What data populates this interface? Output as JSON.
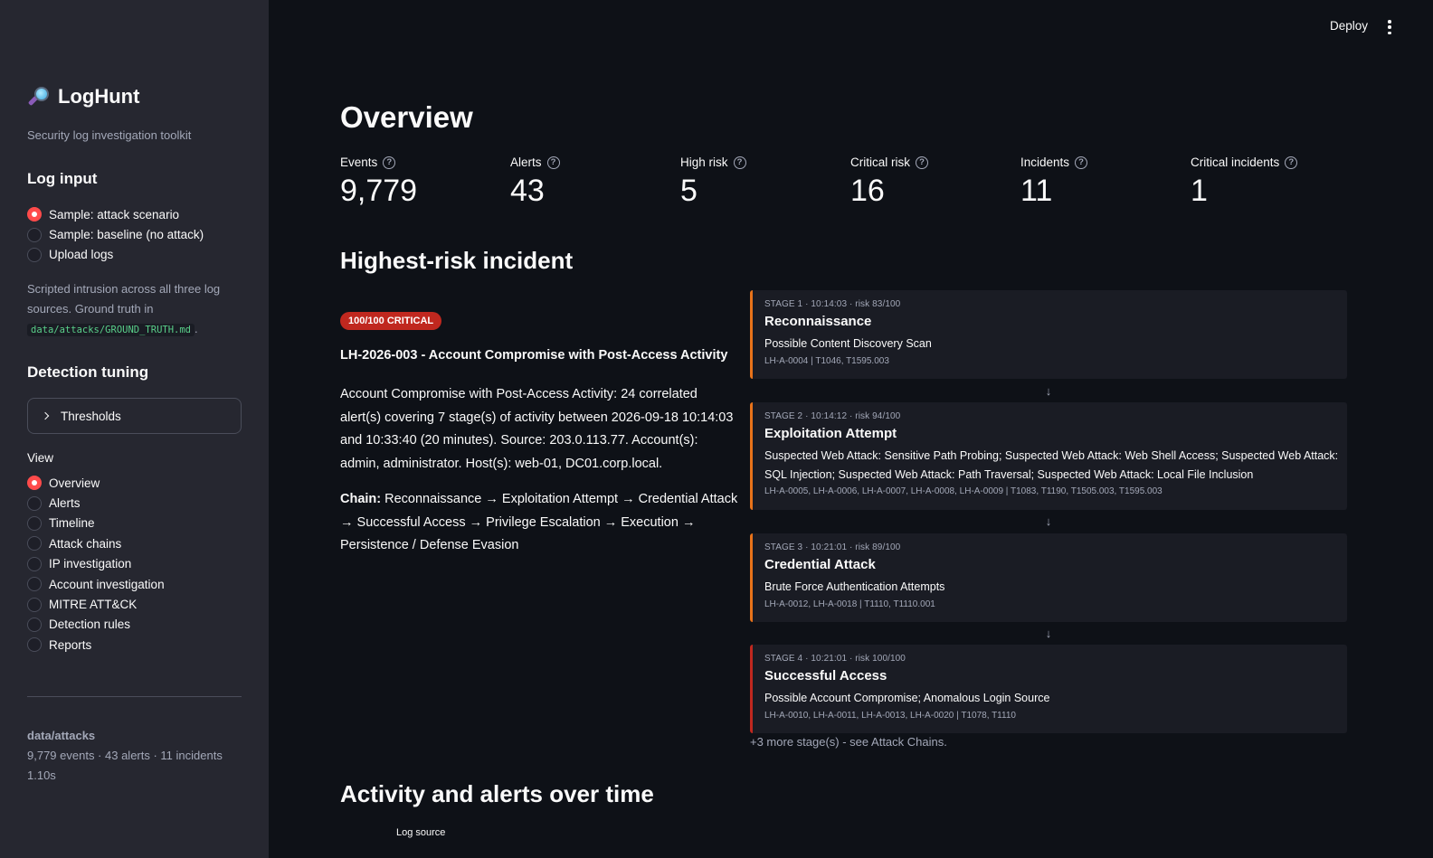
{
  "app": {
    "title": "LogHunt",
    "subtitle": "Security log investigation toolkit",
    "deploy_label": "Deploy"
  },
  "sidebar": {
    "log_input_heading": "Log input",
    "log_inputs": [
      {
        "label": "Sample: attack scenario",
        "selected": true
      },
      {
        "label": "Sample: baseline (no attack)",
        "selected": false
      },
      {
        "label": "Upload logs",
        "selected": false
      }
    ],
    "note_text": "Scripted intrusion across all three log sources. Ground truth in ",
    "note_code": "data/attacks/GROUND_TRUTH.md",
    "note_end": ".",
    "detection_heading": "Detection tuning",
    "thresholds_label": "Thresholds",
    "view_label": "View",
    "views": [
      {
        "label": "Overview",
        "selected": true
      },
      {
        "label": "Alerts",
        "selected": false
      },
      {
        "label": "Timeline",
        "selected": false
      },
      {
        "label": "Attack chains",
        "selected": false
      },
      {
        "label": "IP investigation",
        "selected": false
      },
      {
        "label": "Account investigation",
        "selected": false
      },
      {
        "label": "MITRE ATT&CK",
        "selected": false
      },
      {
        "label": "Detection rules",
        "selected": false
      },
      {
        "label": "Reports",
        "selected": false
      }
    ],
    "meta_source": "data/attacks",
    "meta_counts": "9,779 events · 43 alerts · 11 incidents",
    "meta_time": "1.10s"
  },
  "overview": {
    "title": "Overview",
    "metrics": [
      {
        "label": "Events",
        "value": "9,779"
      },
      {
        "label": "Alerts",
        "value": "43"
      },
      {
        "label": "High risk",
        "value": "5"
      },
      {
        "label": "Critical risk",
        "value": "16"
      },
      {
        "label": "Incidents",
        "value": "11"
      },
      {
        "label": "Critical incidents",
        "value": "1"
      }
    ],
    "highest_heading": "Highest-risk incident",
    "badge": "100/100 CRITICAL",
    "incident_title": "LH-2026-003 - Account Compromise with Post-Access Activity",
    "incident_description": "Account Compromise with Post-Access Activity: 24 correlated alert(s) covering 7 stage(s) of activity between 2026-09-18 10:14:03 and 10:33:40 (20 minutes). Source: 203.0.113.77. Account(s): admin, administrator. Host(s): web-01, DC01.corp.local.",
    "chain_label": "Chain:",
    "chain_text": " Reconnaissance → Exploitation Attempt → Credential Attack → Successful Access → Privilege Escalation → Execution → Persistence / Defense Evasion",
    "stages": [
      {
        "header": "STAGE 1 · 10:14:03 · risk 83/100",
        "name": "Reconnaissance",
        "detail": "Possible Content Discovery Scan",
        "ids": "LH-A-0004 | T1046, T1595.003",
        "severity": "high"
      },
      {
        "header": "STAGE 2 · 10:14:12 · risk 94/100",
        "name": "Exploitation Attempt",
        "detail": "Suspected Web Attack: Sensitive Path Probing; Suspected Web Attack: Web Shell Access; Suspected Web Attack: SQL Injection; Suspected Web Attack: Path Traversal; Suspected Web Attack: Local File Inclusion",
        "ids": "LH-A-0005, LH-A-0006, LH-A-0007, LH-A-0008, LH-A-0009 | T1083, T1190, T1505.003, T1595.003",
        "severity": "high"
      },
      {
        "header": "STAGE 3 · 10:21:01 · risk 89/100",
        "name": "Credential Attack",
        "detail": "Brute Force Authentication Attempts",
        "ids": "LH-A-0012, LH-A-0018 | T1110, T1110.001",
        "severity": "high"
      },
      {
        "header": "STAGE 4 · 10:21:01 · risk 100/100",
        "name": "Successful Access",
        "detail": "Possible Account Compromise; Anomalous Login Source",
        "ids": "LH-A-0010, LH-A-0011, LH-A-0013, LH-A-0020 | T1078, T1110",
        "severity": "critical"
      }
    ],
    "more_stages": "+3 more stage(s) - see Attack Chains.",
    "activity_heading": "Activity and alerts over time",
    "legend_title": "Log source"
  },
  "colors": {
    "accent": "#ff4b4b",
    "high": "#e8731a",
    "critical": "#c0281f"
  }
}
